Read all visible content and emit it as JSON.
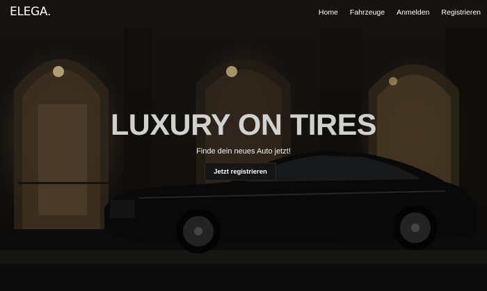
{
  "brand": {
    "logo": "ELEGA."
  },
  "nav": {
    "items": [
      {
        "label": "Home"
      },
      {
        "label": "Fahrzeuge"
      },
      {
        "label": "Anmelden"
      },
      {
        "label": "Registrieren"
      }
    ]
  },
  "hero": {
    "title": "LUXURY ON TIRES",
    "subtitle": "Finde dein neues Auto jetzt!",
    "cta_label": "Jetzt registrieren",
    "background_image": "night-street-luxury-sedan"
  },
  "colors": {
    "text": "#ffffff",
    "button_bg": "#161616",
    "warm_light": "#c9a56a"
  }
}
